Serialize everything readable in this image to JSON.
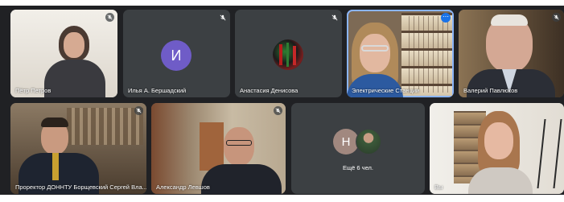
{
  "colors": {
    "background": "#202124",
    "tile": "#3c4043",
    "active_border": "#8ab4f8",
    "avatar_i": "#6f5cc7",
    "avatar_n": "#a1887f",
    "more_button": "#1a73e8"
  },
  "participants": [
    {
      "name": "Пётр Петров",
      "mic": "muted"
    },
    {
      "name": "Илья А. Бершадский",
      "avatar_letter": "И",
      "mic": "muted"
    },
    {
      "name": "Анастасия Денисова",
      "mic": "muted"
    },
    {
      "name": "Электрические Станции",
      "mic": "active",
      "icon": "more-options-icon"
    },
    {
      "name": "Валерий Павлюков",
      "mic": "muted"
    },
    {
      "name": "Проректор ДОННТУ Борщевский Сергей Вла...",
      "mic": "muted"
    },
    {
      "name": "Александр Левшов",
      "mic": "muted"
    },
    {
      "name": "Вы",
      "mic": "none"
    }
  ],
  "others": {
    "avatar_letter": "Н",
    "label": "Ещё 6 чел."
  },
  "icons": {
    "mic_off": "mic-off-icon",
    "more": "more-options-icon"
  }
}
